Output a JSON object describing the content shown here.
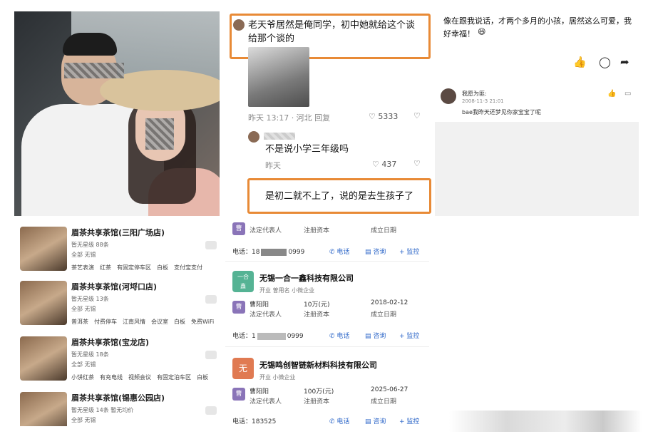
{
  "comments": {
    "highlight1_text_line1": "老天爷居然是俺同学，初中她就给这个谈",
    "highlight1_text_line2": "给那个谈的",
    "c1_meta": "昨天 13:17 · 河北   回复",
    "c1_likes": "5333",
    "c2_text": "不是说小学三年级吗",
    "c2_meta": "昨天",
    "c2_likes": "437",
    "highlight2_text": "是初二就不上了，说的是去生孩子了"
  },
  "post": {
    "text_line1": "像在跟我说话，才两个多月的小孩，居然这么可爱，我",
    "text_line2": "好幸福！",
    "reply_user": "我愿为匪:",
    "reply_time": "2008-11-3 21:01",
    "reply_text": "bae我昨天还梦见你家宝宝了呢"
  },
  "tea": {
    "items": [
      {
        "name": "眉茶共享茶馆(三阳广场店)",
        "line1": "暂无星级 88条",
        "line2": "全部 无锡",
        "tags": [
          "茶艺表演",
          "红茶",
          "有固定停车区",
          "白板",
          "支付宝支付"
        ]
      },
      {
        "name": "眉茶共享茶馆(河埒口店)",
        "line1": "暂无星级 13条",
        "line2": "全部 无锡",
        "tags": [
          "普洱茶",
          "付费停车",
          "江南风情",
          "会议室",
          "白板",
          "免费WiFi"
        ]
      },
      {
        "name": "眉茶共享茶馆(宝龙店)",
        "line1": "暂无星级 18条",
        "line2": "全部 无锡",
        "tags": [
          "小饼红茶",
          "有充电线",
          "视频会议",
          "有固定泊车区",
          "白板"
        ]
      },
      {
        "name": "眉茶共享茶馆(锡惠公园店)",
        "line1": "暂无星级 14条 暂无均价",
        "line2": "全部 无锡",
        "tags": []
      }
    ]
  },
  "company": {
    "top_labels": [
      "法定代表人",
      "注册资本",
      "成立日期"
    ],
    "top_phone": "电话：18",
    "top_phone_tail": "0999",
    "actions": [
      "电话",
      "咨询",
      "+ 监控"
    ],
    "c1": {
      "logo": "一合\n鑫",
      "name": "无锡一合一鑫科技有限公司",
      "tags": "开业  曾用名  小微企业",
      "person": "曹阳阳",
      "capital": "10万(元)",
      "date": "2018-02-12",
      "labels": [
        "法定代表人",
        "注册资本",
        "成立日期"
      ],
      "phone": "电话：1",
      "phone_tail": "0999"
    },
    "c2": {
      "logo": "无",
      "name": "无锡鸣创智链新材料科技有限公司",
      "tags": "开业  小微企业",
      "person": "曹阳阳",
      "capital": "100万(元)",
      "date": "2025-06-27",
      "labels": [
        "法定代表人",
        "注册资本",
        "成立日期"
      ],
      "phone": "电话：183525"
    }
  },
  "colors": {
    "highlight": "#e88a36",
    "action_blue": "#2c66c8",
    "person_purple": "#8a74b8"
  }
}
